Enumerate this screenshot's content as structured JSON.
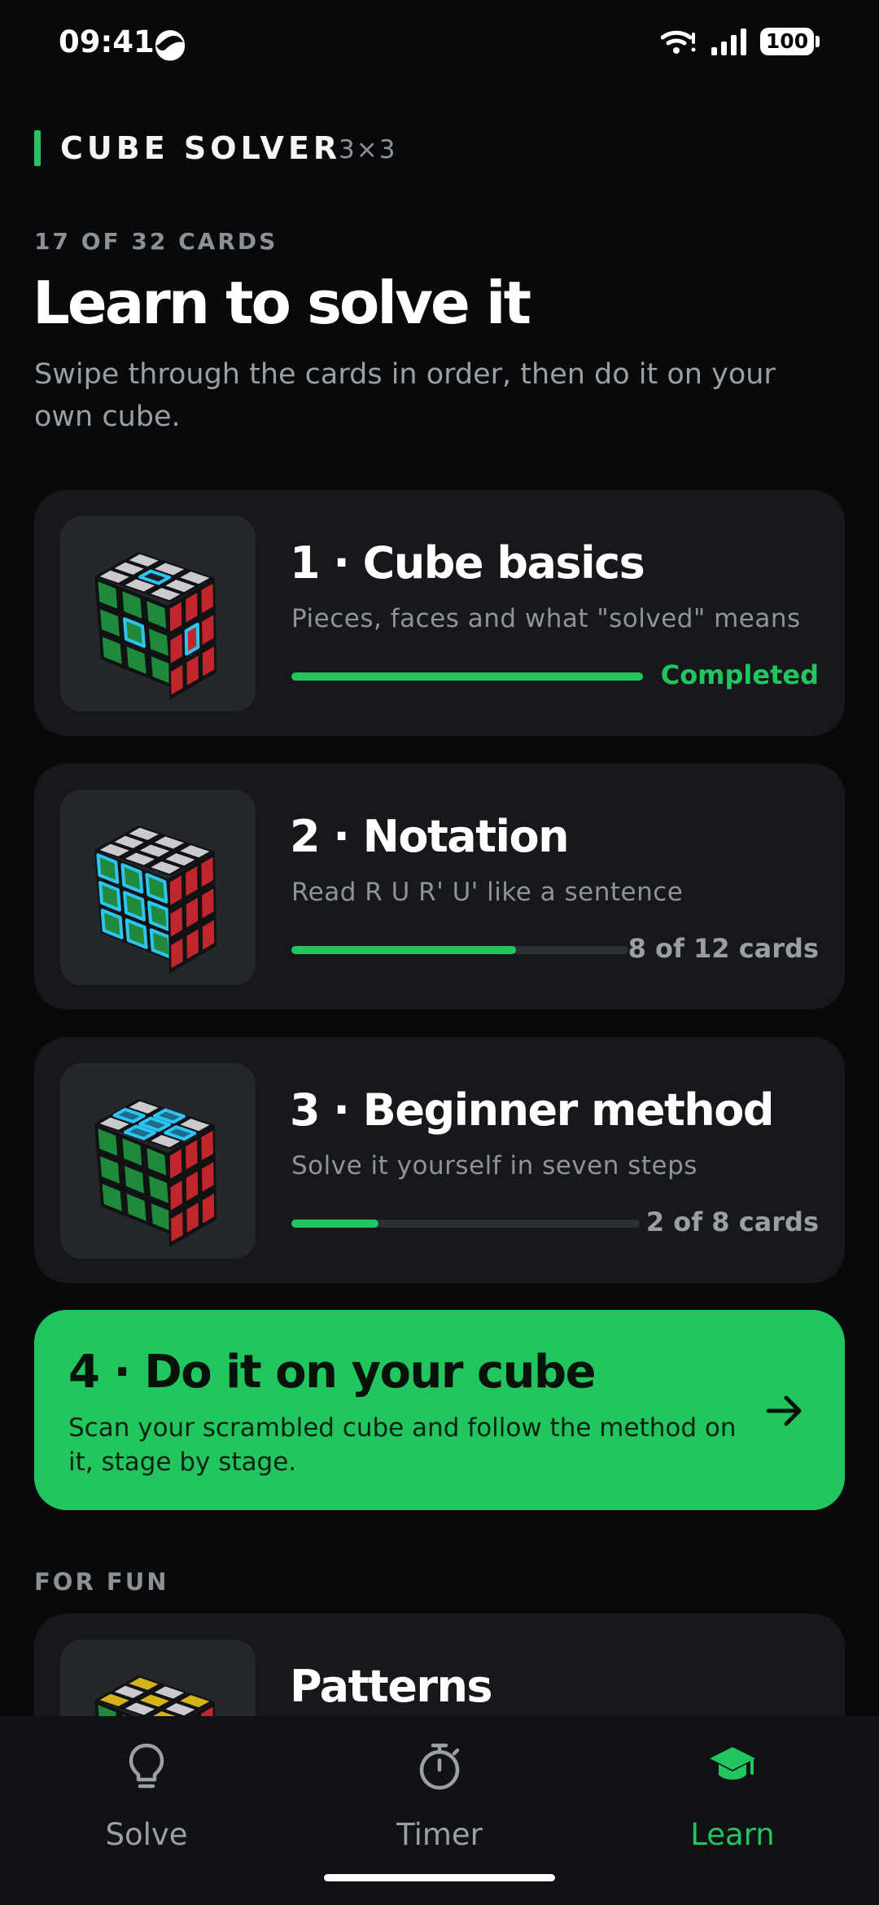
{
  "status_bar": {
    "time": "09:41",
    "battery": "100"
  },
  "header": {
    "app_name": "CUBE SOLVER",
    "cube_size": "3×3"
  },
  "hero": {
    "counter": "17 OF 32 CARDS",
    "title": "Learn to solve it",
    "subtitle": "Swipe through the cards in order, then do it on your own cube."
  },
  "lessons": [
    {
      "title": "1 · Cube basics",
      "description": "Pieces, faces and what \"solved\" means",
      "progress": 1.0,
      "status": "Completed",
      "icon": "cube-highlight-centers-icon"
    },
    {
      "title": "2 · Notation",
      "description": "Read R U R' U' like a sentence",
      "progress": 0.667,
      "status": "8 of 12 cards",
      "icon": "cube-highlight-front-face-icon"
    },
    {
      "title": "3 · Beginner method",
      "description": "Solve it yourself in seven steps",
      "progress": 0.25,
      "status": "2 of 8 cards",
      "icon": "cube-highlight-top-cross-icon"
    }
  ],
  "cta": {
    "title": "4 · Do it on your cube",
    "description": "Scan your scrambled cube and follow the method on it, stage by stage.",
    "icon": "arrow-right-icon"
  },
  "for_fun": {
    "label": "FOR FUN",
    "card_title": "Patterns",
    "icon": "cube-pattern-icon"
  },
  "tabs": [
    {
      "label": "Solve",
      "icon": "lightbulb-icon",
      "active": false
    },
    {
      "label": "Timer",
      "icon": "stopwatch-icon",
      "active": false
    },
    {
      "label": "Learn",
      "icon": "graduation-cap-icon",
      "active": true
    }
  ],
  "colors": {
    "accent": "#22c55e",
    "highlight": "#2ec4f1",
    "background": "#08090b",
    "card": "#16181c"
  }
}
